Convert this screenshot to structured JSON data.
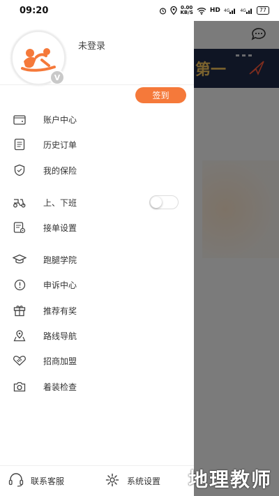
{
  "status_bar": {
    "time": "09:20",
    "net_speed_value": "0.00",
    "net_speed_unit": "KB/S",
    "hd_label": "HD",
    "signal1": "4G",
    "signal2": "4G",
    "battery": "77"
  },
  "drawer": {
    "login_status": "未登录",
    "avatar_badge": "V",
    "signin_label": "签到",
    "menu": [
      {
        "label": "账户中心",
        "icon": "wallet-icon"
      },
      {
        "label": "历史订单",
        "icon": "order-history-icon"
      },
      {
        "label": "我的保险",
        "icon": "shield-icon"
      },
      {
        "label": "上、下班",
        "icon": "scooter-icon"
      },
      {
        "label": "接单设置",
        "icon": "order-settings-icon"
      },
      {
        "label": "跑腿学院",
        "icon": "graduation-cap-icon"
      },
      {
        "label": "申诉中心",
        "icon": "alert-circle-icon"
      },
      {
        "label": "推荐有奖",
        "icon": "gift-icon"
      },
      {
        "label": "路线导航",
        "icon": "map-pin-icon"
      },
      {
        "label": "招商加盟",
        "icon": "handshake-icon"
      },
      {
        "label": "着装检查",
        "icon": "camera-icon"
      }
    ],
    "shift_toggle_on": false,
    "bottom": {
      "support_label": "联系客服",
      "settings_label": "系统设置"
    }
  },
  "background": {
    "banner_text": "第一"
  },
  "watermark": "地理教师",
  "colors": {
    "accent": "#f5793a",
    "overlay": "rgba(0,0,0,0.5)"
  }
}
